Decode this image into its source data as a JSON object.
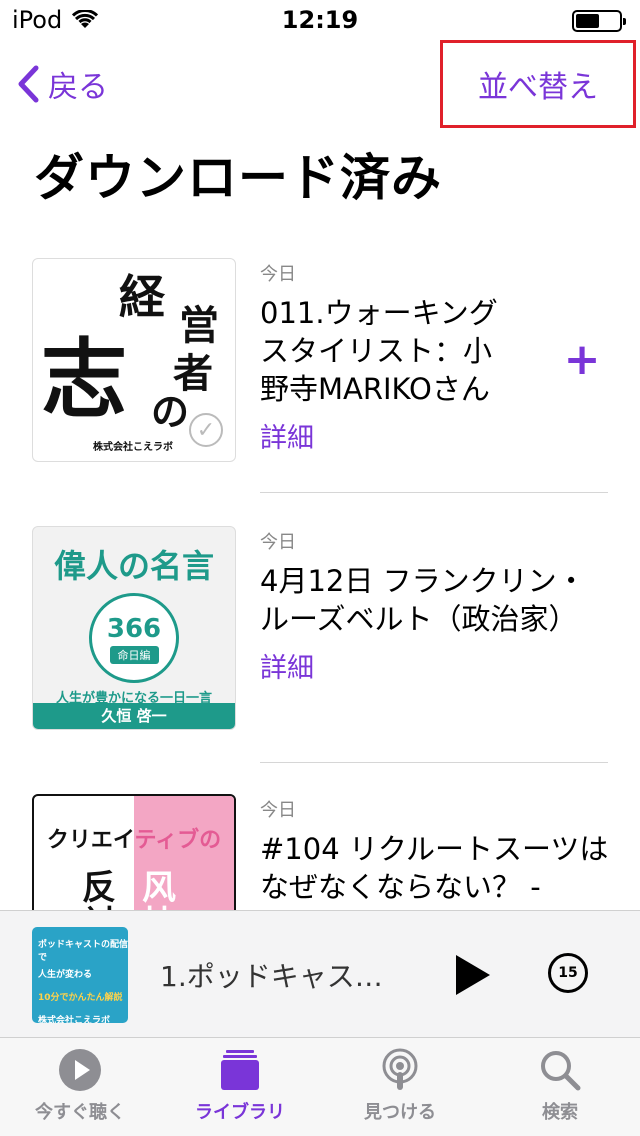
{
  "status_bar": {
    "carrier": "iPod",
    "time": "12:19",
    "battery_level": 0.55
  },
  "nav": {
    "back_label": "戻る",
    "sort_label": "並べ替え"
  },
  "page_title": "ダウンロード済み",
  "episodes": [
    {
      "date": "今日",
      "title": "011.ウォーキングスタイリスト：小野寺MARIKOさん",
      "detail": "詳細",
      "add_label": "+",
      "artwork": {
        "chars": [
          "経",
          "営",
          "者",
          "の",
          "志"
        ],
        "footer": "株式会社こえラボ"
      }
    },
    {
      "date": "今日",
      "title": "4月12日 フランクリン・ルーズベルト（政治家）",
      "detail": "詳細",
      "artwork": {
        "title": "偉人の名言",
        "number": "366",
        "sub": "命日編",
        "tagline": "人生が豊かになる一日一言",
        "author": "久恒 啓一"
      }
    },
    {
      "date": "今日",
      "title": "#104 リクルートスーツはなぜなくならない？ -",
      "artwork": {
        "title_dark": "クリエイ",
        "title_pink": "ティブの",
        "big": [
          "反",
          "対",
          "风",
          "枝"
        ]
      }
    }
  ],
  "mini_player": {
    "title": "1.ポッドキャス…",
    "skip_seconds": "15",
    "artwork_lines": [
      "ポッドキャストの配信で",
      "人生が変わる",
      "10分でかんたん解説",
      "株式会社こえラボ"
    ]
  },
  "tabs": [
    {
      "label": "今すぐ聴く",
      "icon": "play-circle-icon"
    },
    {
      "label": "ライブラリ",
      "icon": "library-icon",
      "active": true
    },
    {
      "label": "見つける",
      "icon": "podcast-icon"
    },
    {
      "label": "検索",
      "icon": "search-icon"
    }
  ]
}
